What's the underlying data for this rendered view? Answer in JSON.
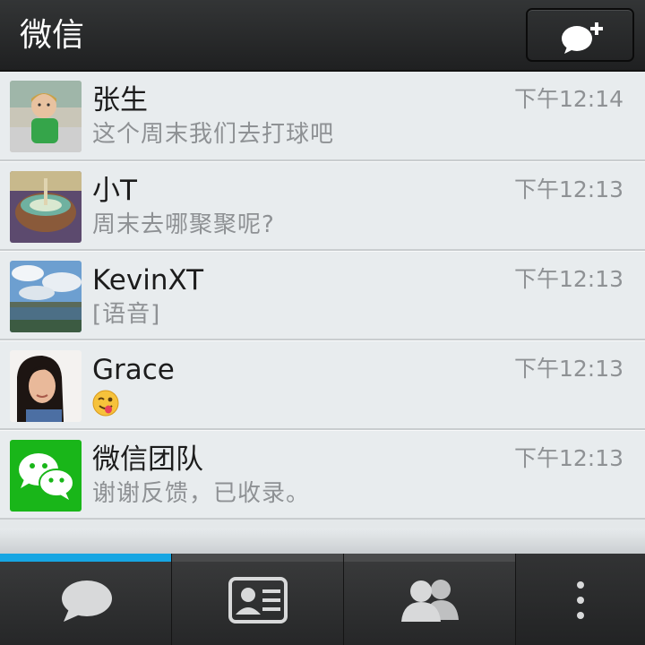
{
  "header": {
    "title": "微信"
  },
  "chats": [
    {
      "name": "张生",
      "preview": "这个周末我们去打球吧",
      "time": "下午12:14",
      "avatar": "child-photo"
    },
    {
      "name": "小T",
      "preview": "周末去哪聚聚呢?",
      "time": "下午12:13",
      "avatar": "drink-photo"
    },
    {
      "name": "KevinXT",
      "preview": "[语音]",
      "time": "下午12:13",
      "avatar": "landscape-photo"
    },
    {
      "name": "Grace",
      "preview": "",
      "time": "下午12:13",
      "avatar": "woman-photo",
      "preview_icon": "winking-tongue-emoji"
    },
    {
      "name": "微信团队",
      "preview": "谢谢反馈，已收录。",
      "time": "下午12:13",
      "avatar": "wechat-logo"
    }
  ],
  "tabs": [
    {
      "icon": "chat-bubble-icon",
      "active": true
    },
    {
      "icon": "contact-card-icon",
      "active": false
    },
    {
      "icon": "friends-icon",
      "active": false
    },
    {
      "icon": "more-vertical-icon",
      "active": false
    }
  ],
  "colors": {
    "accent": "#17a6e3",
    "wechat_green": "#19b619",
    "header_bg": "#2a2b2c",
    "list_bg": "#e8ecee",
    "secondary_text": "#8e9194"
  }
}
